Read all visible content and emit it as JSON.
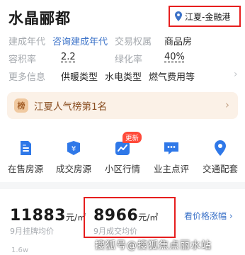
{
  "header": {
    "title": "水晶郦都",
    "location": "江夏-金融港"
  },
  "attributes": {
    "row1": {
      "label1": "建成年代",
      "value1": "咨询建成年代",
      "label2": "交易权属",
      "value2": "商品房"
    },
    "row2": {
      "label1": "容积率",
      "value1": "2.2",
      "label2": "绿化率",
      "value2": "40%"
    },
    "row3": {
      "label": "更多信息",
      "items": [
        "供暖类型",
        "水电类型",
        "燃气费用等"
      ],
      "arrow": "›"
    }
  },
  "ranking": {
    "badge": "榜",
    "text": "江夏人气榜第1名",
    "arrow": "›"
  },
  "quick_entries": [
    {
      "label": "在售房源",
      "icon": "house-listing-icon"
    },
    {
      "label": "成交房源",
      "icon": "deal-icon"
    },
    {
      "label": "小区行情",
      "icon": "market-trend-icon",
      "badge": "更新"
    },
    {
      "label": "业主点评",
      "icon": "comment-icon"
    },
    {
      "label": "交通配套",
      "icon": "map-pin-icon"
    }
  ],
  "prices": {
    "listing": {
      "value": "11883",
      "unit": "元/㎡",
      "label": "9月挂牌均价"
    },
    "deal": {
      "value": "8966",
      "unit": "元/㎡",
      "label": "9月成交均价"
    },
    "trend_link": "看价格涨幅 ›"
  },
  "chart_tick": "1.6w",
  "watermark": "搜狐号@搜狐焦点丽水站",
  "colors": {
    "accent_blue": "#3b72c8",
    "highlight_red": "#e61e1e",
    "rank_bg": "#fbf1e7"
  }
}
